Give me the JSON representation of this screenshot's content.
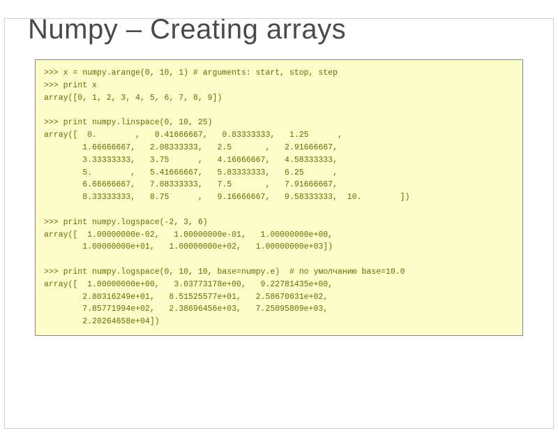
{
  "title": "Numpy – Creating arrays",
  "code": {
    "l1": ">>> x = numpy.arange(0, 10, 1) # arguments: start, stop, step",
    "l2": ">>> print x",
    "l3": "array([0, 1, 2, 3, 4, 5, 6, 7, 8, 9])",
    "l4": "",
    "l5": ">>> print numpy.linspace(0, 10, 25)",
    "l6": "array([  0.        ,   0.41666667,   0.83333333,   1.25      ,",
    "l7": "        1.66666667,   2.08333333,   2.5       ,   2.91666667,",
    "l8": "        3.33333333,   3.75      ,   4.16666667,   4.58333333,",
    "l9": "        5.        ,   5.41666667,   5.83333333,   6.25      ,",
    "l10": "        6.66666667,   7.08333333,   7.5       ,   7.91666667,",
    "l11": "        8.33333333,   8.75      ,   9.16666667,   9.58333333,  10.        ])",
    "l12": "",
    "l13": ">>> print numpy.logspace(-2, 3, 6)",
    "l14": "array([  1.00000000e-02,   1.00000000e-01,   1.00000000e+00,",
    "l15": "        1.00000000e+01,   1.00000000e+02,   1.00000000e+03])",
    "l16": "",
    "l17": ">>> print numpy.logspace(0, 10, 10, base=numpy.e)  # по умолчанию base=10.0",
    "l18": "array([  1.00000000e+00,   3.03773178e+00,   9.22781435e+00,",
    "l19": "        2.80316249e+01,   8.51525577e+01,   2.58670631e+02,",
    "l20": "        7.85771994e+02,   2.38696456e+03,   7.25095809e+03,",
    "l21": "        2.20264658e+04])"
  }
}
